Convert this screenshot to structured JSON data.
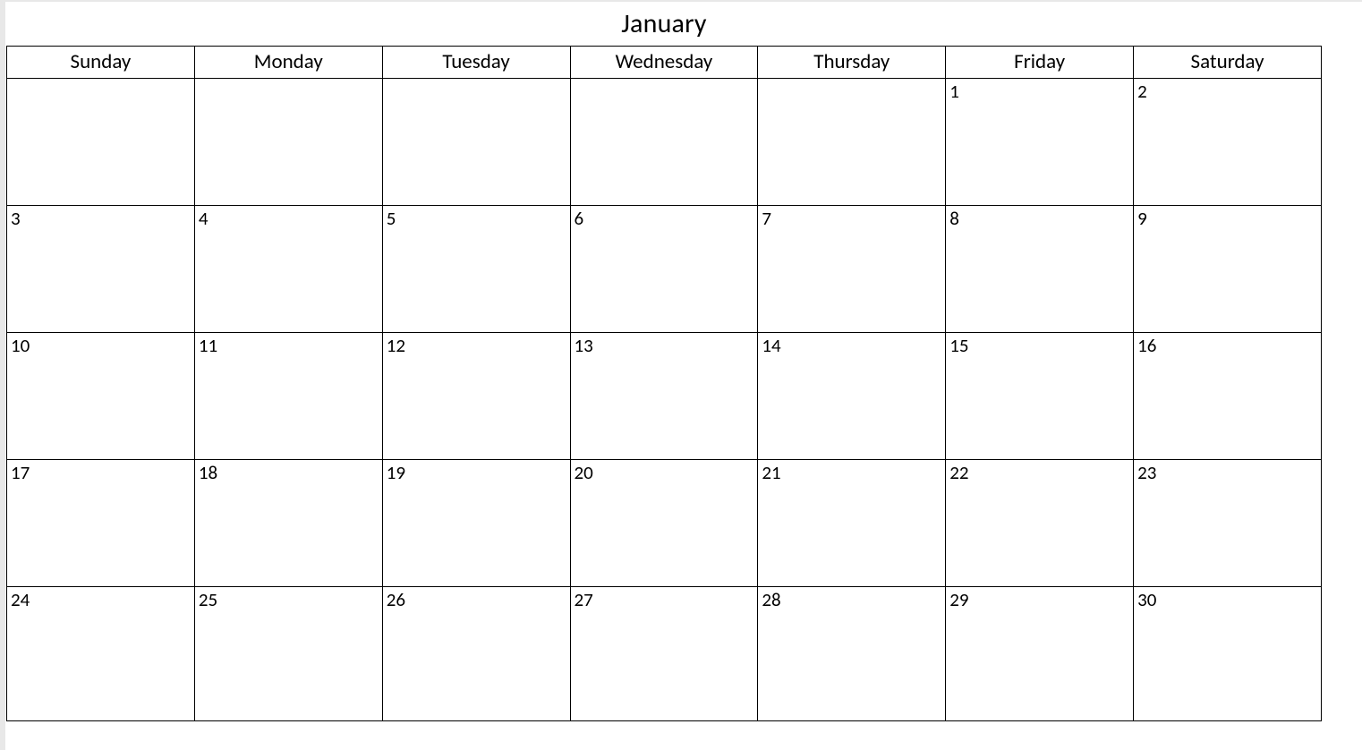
{
  "calendar": {
    "monthTitle": "January",
    "dayHeaders": [
      "Sunday",
      "Monday",
      "Tuesday",
      "Wednesday",
      "Thursday",
      "Friday",
      "Saturday"
    ],
    "weeks": [
      [
        "",
        "",
        "",
        "",
        "",
        "1",
        "2"
      ],
      [
        "3",
        "4",
        "5",
        "6",
        "7",
        "8",
        "9"
      ],
      [
        "10",
        "11",
        "12",
        "13",
        "14",
        "15",
        "16"
      ],
      [
        "17",
        "18",
        "19",
        "20",
        "21",
        "22",
        "23"
      ],
      [
        "24",
        "25",
        "26",
        "27",
        "28",
        "29",
        "30"
      ]
    ]
  }
}
